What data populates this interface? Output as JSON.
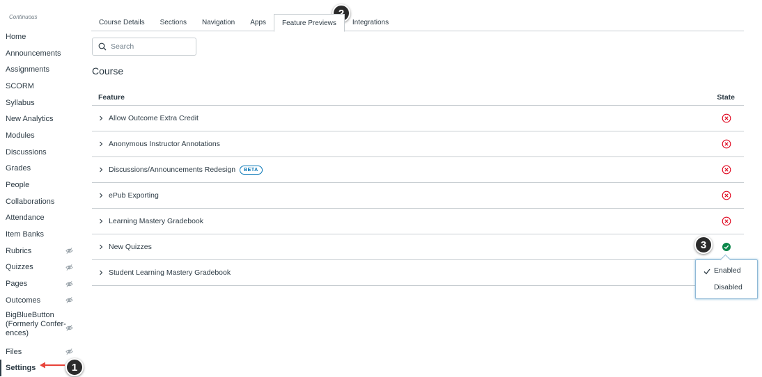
{
  "sidebar": {
    "term": "Continuous",
    "items": [
      {
        "label": "Home"
      },
      {
        "label": "Announcements"
      },
      {
        "label": "Assignments"
      },
      {
        "label": "SCORM"
      },
      {
        "label": "Syllabus"
      },
      {
        "label": "New Analytics"
      },
      {
        "label": "Modules"
      },
      {
        "label": "Discussions"
      },
      {
        "label": "Grades"
      },
      {
        "label": "People"
      },
      {
        "label": "Collaborations"
      },
      {
        "label": "Attendance"
      },
      {
        "label": "Item Banks"
      },
      {
        "label": "Rubrics",
        "hidden_icon": "eye-slash-icon"
      },
      {
        "label": "Quizzes",
        "hidden_icon": "eye-slash-icon"
      },
      {
        "label": "Pages",
        "hidden_icon": "eye-slash-icon"
      },
      {
        "label": "Outcomes",
        "hidden_icon": "eye-slash-icon"
      },
      {
        "label": "BigBlueButton (Formerly Confer- ences)",
        "hidden_icon": "eye-slash-icon"
      },
      {
        "label": "Files",
        "hidden_icon": "eye-slash-icon"
      },
      {
        "label": "Settings",
        "active": true
      }
    ]
  },
  "callouts": [
    "1",
    "2",
    "3"
  ],
  "tabs": [
    {
      "label": "Course Details"
    },
    {
      "label": "Sections"
    },
    {
      "label": "Navigation"
    },
    {
      "label": "Apps"
    },
    {
      "label": "Feature Previews",
      "active": true
    },
    {
      "label": "Integrations"
    }
  ],
  "search": {
    "placeholder": "Search",
    "value": ""
  },
  "section_title": "Course",
  "table": {
    "headers": {
      "feature": "Feature",
      "state": "State"
    },
    "rows": [
      {
        "name": "Allow Outcome Extra Credit",
        "state": "disabled"
      },
      {
        "name": "Anonymous Instructor Annotations",
        "state": "disabled"
      },
      {
        "name": "Discussions/Announcements Redesign",
        "badge": "BETA",
        "state": "disabled"
      },
      {
        "name": "ePub Exporting",
        "state": "disabled"
      },
      {
        "name": "Learning Mastery Gradebook",
        "state": "disabled"
      },
      {
        "name": "New Quizzes",
        "state": "enabled"
      },
      {
        "name": "Student Learning Mastery Gradebook",
        "state": "none"
      }
    ]
  },
  "dropdown": {
    "options": [
      {
        "label": "Enabled",
        "checked": true
      },
      {
        "label": "Disabled",
        "checked": false
      }
    ]
  },
  "colors": {
    "disabled": "#e0061f",
    "enabled": "#0b874b",
    "accent": "#0374b5",
    "callout_arrow": "#e8453c"
  }
}
